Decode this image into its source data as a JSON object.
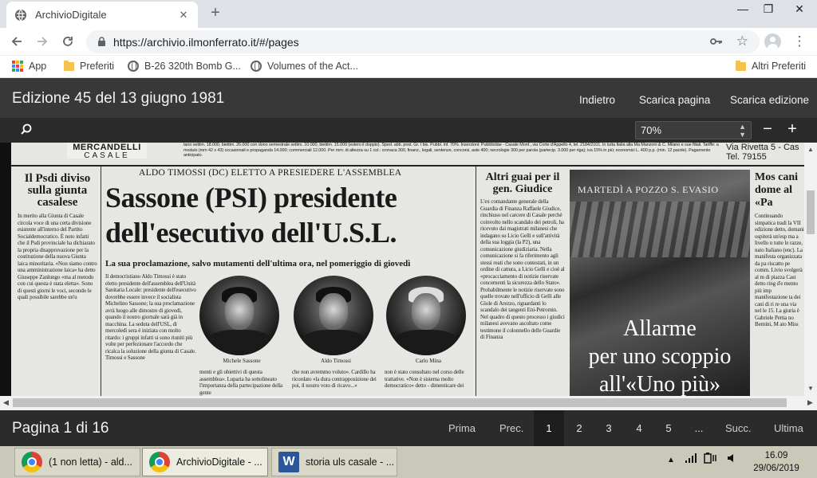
{
  "browser": {
    "tab_title": "ArchivioDigitale",
    "tab_close": "✕",
    "new_tab": "+",
    "window_controls": {
      "minimize": "—",
      "restore": "❐",
      "close": "✕"
    },
    "url": "https://archivio.ilmonferrato.it/#/pages",
    "bookmarks": [
      {
        "label": "App",
        "icon": "apps-grid-icon"
      },
      {
        "label": "Preferiti",
        "icon": "folder-icon"
      },
      {
        "label": "B-26 320th Bomb G...",
        "icon": "globe-icon"
      },
      {
        "label": "Volumes of the Act...",
        "icon": "globe-icon"
      },
      {
        "label": "Altri Preferiti",
        "icon": "folder-icon"
      }
    ]
  },
  "viewer": {
    "edition_title": "Edizione 45 del 13 giugno 1981",
    "actions": {
      "back": "Indietro",
      "download_page": "Scarica pagina",
      "download_edition": "Scarica edizione"
    },
    "zoom_value": "70%",
    "zoom_minus": "−",
    "zoom_plus": "+"
  },
  "newspaper": {
    "ad_top": "MERCANDELLI",
    "ad_sub": "CASALE",
    "masthead_strip": "tano settim. 18.000, biettim. 26.000 con dono semestrale settim. 10.000, biettim. 15.000 (estero il doppio). Sped. abb. post. Gr. I bis. Pubbl. inf. 70%. Inserzioni: Pubblicitàe - Casale Monf., via Corte d'Appello 4, tel. 2184/2101. In tutta Italia alla Ma Manzoni & C. Milano e sue filiali. Tariffe: a modulo (mm 42 x 43) occasionali e propaganda 14.000; commerciali 12.000. Per mm. di altezza su 1 col.: cronaca 300, finanz., legali, sentenze, concorsi, aste 400; necrologie 300 per parola (partecip. 3.000 per riga); iva 15% in più; economici L. 400 p.p. (min. 12 parole). Pagamento anticipato.",
    "ad_right": "Via Rivetta 5 - Cas",
    "ad_right_tel": "Tel. 79155",
    "left_headline": "Il Psdi diviso sulla giunta casalese",
    "left_body": "In merito alla Giunta di Casale circola voce di una certa divisione esistente all'interno del Partito Socialdemocratico. È noto infatti che il Psdi provinciale ha dichiarato la propria disapprovazione per la costituzione della nuova Giunta laica minoritaria. «Non siamo contro una amministrazione laica» ha detto Giuseppe Zanlungo «ma al metodo con cui questa è stata eletta». Sono di questi giorni le voci, secondo le quali possibile sarebbe un'u",
    "kicker": "ALDO TIMOSSI (DC) ELETTO A PRESIEDERE L'ASSEMBLEA",
    "main_headline_1": "Sassone (PSI) presidente",
    "main_headline_2": "dell'esecutivo dell'U.S.L.",
    "subhead": "La sua proclamazione, salvo mutamenti dell'ultima ora, nel pomeriggio di giovedì",
    "main_body": "Il democristiano Aldo Timossi è stato eletto presidente dell'assemblea dell'Unità Sanitaria Locale: presidente dell'esecutivo dovrebbe essere invece il socialista Michelino Sassone; la sua proclamazione avrà luogo alle dimostre di giovedì, quando il nostro giornale sarà già in macchina. La seduta dell'USL, di mercoledì sera è iniziata con molto ritardo: i gruppi infatti si sono riuniti più volte per perfezionare l'accordo che ricalca la soluzione della giunta di Casale. Timossi e Sassone",
    "caption_1": "Michele Sassone",
    "caption_2": "Aldo Timossi",
    "caption_3": "Carlo Mina",
    "body_bottom_1": "menti e gli obiettivi di questa assemblea». Luparia ha sottolineato l'importanza della partecipazione della gente",
    "body_bottom_2": "che non avremmo voluto». Cardillo ha ricordato «la dura contrapposizione dei poi, il nostro voto di ricavo...»",
    "body_bottom_3": "non è stato consultato nel corso delle trattative. «Non è sistema molto democratico» detto - dimenticare dei",
    "right_headline": "Altri guai per il gen. Giudice",
    "right_body": "L'ex comandante generale della Guardia di Finanza Raffaele Giudice, rinchiuso nel carcere di Casale perché coinvolto nello scandalo dei petroli, ha ricevuto dai magistrati milanesi che indagano su Licio Gelli e sull'attività della sua loggia (la P2), una comunicazione giudiziaria. Nella comunicazione si fa riferimento agli stessi reati che sono contestati, in un ordine di cattura, a Licio Gelli e cioè al «procacciamento di notizie riservate concernenti la sicurezza dello Stato». Probabilmente le notizie riservate sono quelle trovate nell'ufficio di Gelli alle Gìole di Arezzo, riguardanti lo scandalo dei tangenti Eni-Petromin. Nel quadro di questo processo i giudici milanesi avevano ascoltato come testimone il colonnello delle Guardie di Finanza",
    "photo_caption": "MARTEDÌ A POZZO S. EVASIO",
    "alarm_1": "Allarme",
    "alarm_2": "per uno scoppio",
    "alarm_3": "all'«Uno più»",
    "far_right_headline": "Mos cani dome al «Pa",
    "far_right_body": "Continuando simpatica tradi la VII edizione detto, domani ospiterà un'esp ma a livello n tutte le razze, nato Italiano (enc). La manifesta organizzata da pa riscatto pe comm. Livio svolgerà al m di piazza Cast detto ring d'e mento più imp manifestazione ta dei cani di ri re una via nel le 15. La giuria è Gabriele Pettia no Bernini, M ato Miss"
  },
  "pager": {
    "info": "Pagina 1 di 16",
    "first": "Prima",
    "prev": "Prec.",
    "pages": [
      "1",
      "2",
      "3",
      "4",
      "5",
      "..."
    ],
    "current": "1",
    "next": "Succ.",
    "last": "Ultima"
  },
  "taskbar": {
    "items": [
      {
        "label": "(1 non letta) - ald...",
        "app": "chrome"
      },
      {
        "label": "ArchivioDigitale - ...",
        "app": "chrome"
      },
      {
        "label": "storia uls casale - ...",
        "app": "word"
      }
    ],
    "clock_time": "16.09",
    "clock_date": "29/06/2019"
  }
}
